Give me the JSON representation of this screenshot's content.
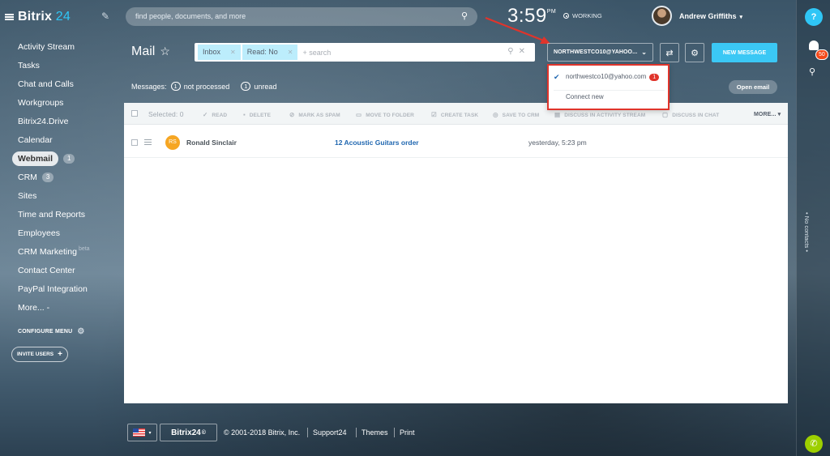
{
  "app": {
    "name": "Bitrix",
    "name_num": "24"
  },
  "topbar": {
    "search_placeholder": "find people, documents, and more",
    "clock": "3:59",
    "clock_ampm": "PM",
    "status": "WORKING",
    "user_name": "Andrew Griffiths"
  },
  "sidebar": {
    "items": [
      {
        "label": "Activity Stream"
      },
      {
        "label": "Tasks"
      },
      {
        "label": "Chat and Calls"
      },
      {
        "label": "Workgroups"
      },
      {
        "label": "Bitrix24.Drive"
      },
      {
        "label": "Calendar"
      },
      {
        "label": "Webmail",
        "badge": "1"
      },
      {
        "label": "CRM",
        "badge": "3"
      },
      {
        "label": "Sites"
      },
      {
        "label": "Time and Reports"
      },
      {
        "label": "Employees"
      },
      {
        "label": "CRM Marketing",
        "tag": "beta"
      },
      {
        "label": "Contact Center"
      },
      {
        "label": "PayPal Integration"
      },
      {
        "label": "More... -"
      }
    ],
    "configure_menu": "CONFIGURE MENU",
    "invite_users": "INVITE USERS"
  },
  "rightpanel": {
    "help": "?",
    "notifications_count": "50",
    "no_contacts": "• No contacts •"
  },
  "mail": {
    "title": "Mail",
    "filters": [
      "Inbox",
      "Read: No"
    ],
    "filter_placeholder": "+ search",
    "mailbox": "NORTHWESTCO10@YAHOO...",
    "new_message": "NEW MESSAGE",
    "messages_label": "Messages:",
    "not_processed_count": "1",
    "not_processed_label": "not processed",
    "unread_count": "1",
    "unread_label": "unread",
    "open_email": "Open email"
  },
  "toolbar": {
    "selected": "Selected: 0",
    "read": "READ",
    "delete": "DELETE",
    "spam": "MARK AS SPAM",
    "move": "MOVE TO FOLDER",
    "task": "CREATE TASK",
    "crm": "SAVE TO CRM",
    "stream": "DISCUSS IN ACTIVITY STREAM",
    "chat": "DISCUSS IN CHAT",
    "more": "MORE..."
  },
  "messages": [
    {
      "initials": "RS",
      "from": "Ronald Sinclair",
      "subject": "12 Acoustic Guitars order",
      "date": "yesterday, 5:23 pm"
    }
  ],
  "dropdown": {
    "account": "northwestco10@yahoo.com",
    "account_badge": "1",
    "connect_new": "Connect new"
  },
  "footer": {
    "brand": "Bitrix24",
    "brand_mark": "©",
    "copyright": "© 2001-2018 Bitrix, Inc.",
    "support": "Support24",
    "themes": "Themes",
    "print": "Print"
  },
  "colors": {
    "accent": "#2fc6f6",
    "highlight": "#e0342b",
    "link": "#2067b0",
    "avatar": "#f6a623"
  }
}
